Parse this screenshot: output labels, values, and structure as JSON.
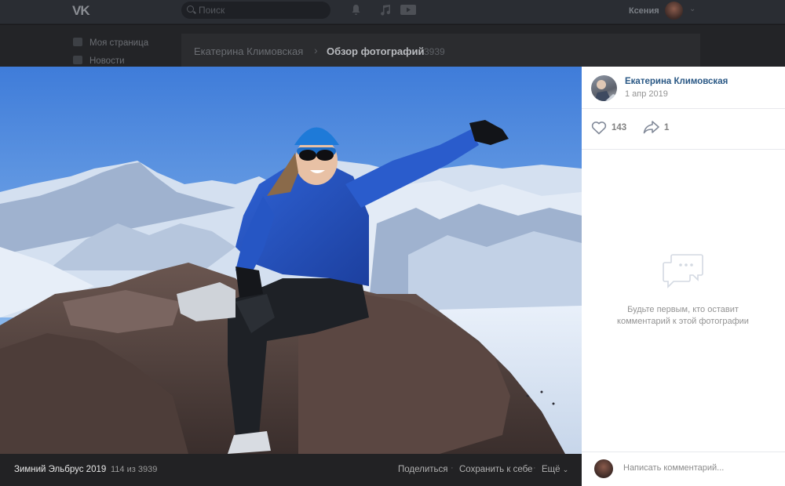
{
  "topbar": {
    "logo": "VK",
    "search_placeholder": "Поиск",
    "user_name": "Ксения"
  },
  "left_nav": {
    "items": [
      {
        "label": "Моя страница",
        "icon": "home-icon"
      },
      {
        "label": "Новости",
        "icon": "news-icon"
      }
    ]
  },
  "breadcrumb": {
    "author": "Екатерина Климовская",
    "current": "Обзор фотографий",
    "count": "3939"
  },
  "viewer": {
    "album_title": "Зимний Эльбрус 2019",
    "counter": "114 из 3939",
    "share_label": "Поделиться",
    "save_label": "Сохранить к себе",
    "more_label": "Ещё"
  },
  "side_panel": {
    "author_name": "Екатерина Климовская",
    "date": "1 апр 2019",
    "likes": "143",
    "shares": "1",
    "empty_comments": "Будьте первым, кто оставит комментарий к этой фотографии",
    "comment_placeholder": "Написать комментарий..."
  },
  "colors": {
    "link_blue": "#2a5885",
    "page_dark": "#1b1b1d",
    "footer": "#222224"
  }
}
